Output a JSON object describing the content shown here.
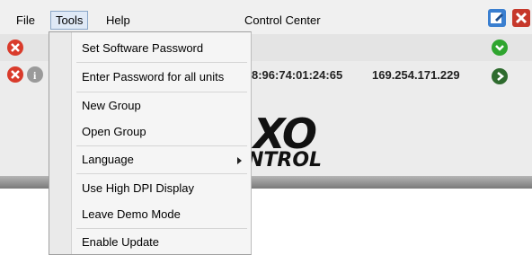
{
  "menubar": {
    "file": "File",
    "tools": "Tools",
    "help": "Help",
    "title": "Control Center"
  },
  "device_row": {
    "mac": "8:96:74:01:24:65",
    "ip": "169.254.171.229"
  },
  "logo": {
    "line1": "XO",
    "line2": "NTROL"
  },
  "tools_menu": {
    "items": [
      "Set Software Password",
      "Enter Password for all units",
      "New Group",
      "Open Group",
      "Language",
      "Use High DPI Display",
      "Leave Demo Mode",
      "Enable Update"
    ]
  },
  "colors": {
    "red_status": "#d93b2b",
    "green_status": "#2fa52f",
    "dark_green_arrow": "#2e6b2e",
    "menu_highlight": "#dfe9f6"
  }
}
